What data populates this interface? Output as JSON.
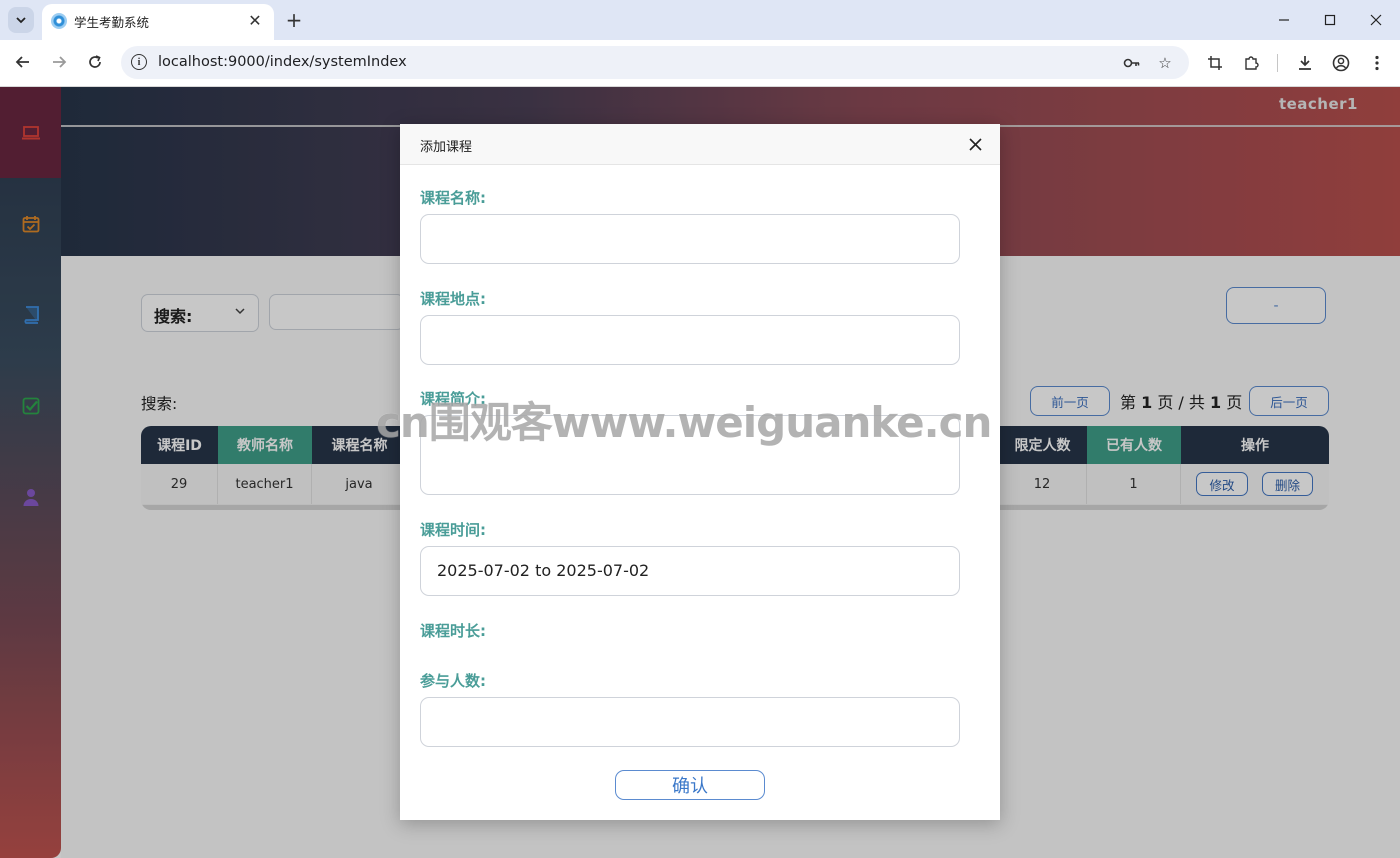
{
  "browser": {
    "tab_title": "学生考勤系统",
    "url": "localhost:9000/index/systemIndex"
  },
  "header": {
    "user_name": "teacher1"
  },
  "sidebar": {
    "items": [
      {
        "icon": "laptop-icon",
        "color": "#e0453c"
      },
      {
        "icon": "calendar-check-icon",
        "color": "#e08a2a"
      },
      {
        "icon": "book-icon",
        "color": "#3f8fe0"
      },
      {
        "icon": "check-box-icon",
        "color": "#2fa84f"
      },
      {
        "icon": "user-icon",
        "color": "#8a5cc9"
      }
    ]
  },
  "toolbar": {
    "search_select": "搜索:",
    "add_button_label": "-"
  },
  "list": {
    "search_label": "搜索:",
    "prev_page": "前一页",
    "next_page": "后一页",
    "page_prefix": "第",
    "page_current": "1",
    "page_mid": "页 / 共",
    "page_total": "1",
    "page_suffix": "页"
  },
  "table": {
    "columns": [
      "课程ID",
      "教师名称",
      "课程名称",
      "限定人数",
      "已有人数",
      "操作"
    ],
    "rows": [
      {
        "id": "29",
        "teacher": "teacher1",
        "course": "java",
        "limit": "12",
        "current": "1",
        "edit": "修改",
        "delete": "删除"
      }
    ]
  },
  "modal": {
    "title": "添加课程",
    "fields": {
      "name_label": "课程名称:",
      "place_label": "课程地点:",
      "intro_label": "课程简介:",
      "time_label": "课程时间:",
      "time_value": "2025-07-02 to 2025-07-02",
      "duration_label": "课程时长:",
      "people_label": "参与人数:"
    },
    "confirm_label": "确认"
  },
  "watermark": "cn围观客www.weiguanke.cn",
  "colors": {
    "accent": "#5b8bd0",
    "label_teal": "#4a9d98",
    "header_dark": "#27354a",
    "header_green": "#3f9f8a"
  }
}
